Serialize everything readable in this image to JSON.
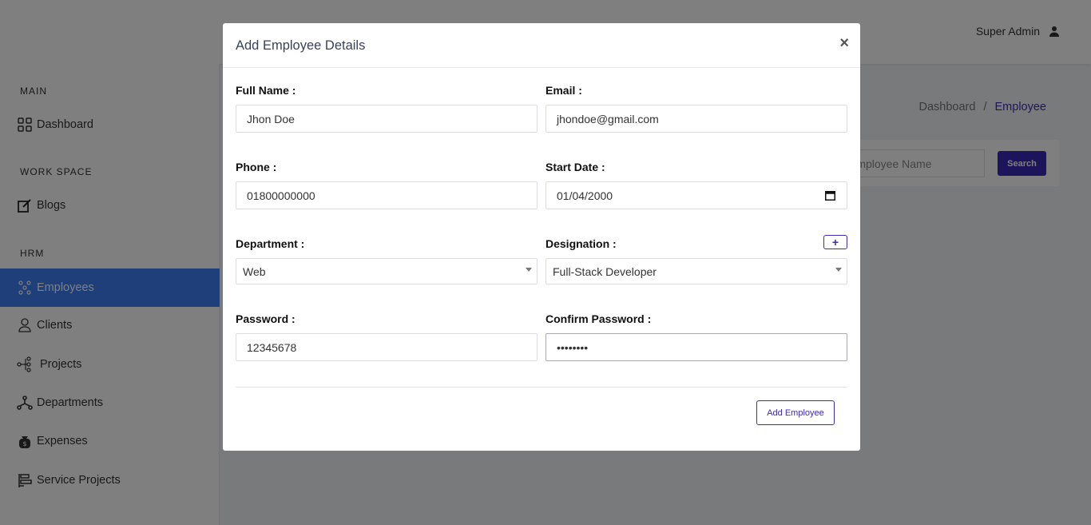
{
  "header": {
    "user_name": "Super Admin"
  },
  "sidebar": {
    "sections": [
      "MAIN",
      "WORK SPACE",
      "HRM"
    ],
    "items": [
      {
        "label": "Dashboard",
        "icon": "grid-icon"
      },
      {
        "label": "Blogs",
        "icon": "edit-icon"
      },
      {
        "label": "Employees",
        "icon": "users-icon",
        "active": true
      },
      {
        "label": "Clients",
        "icon": "user-icon"
      },
      {
        "label": "Projects",
        "icon": "nodes-icon"
      },
      {
        "label": "Departments",
        "icon": "hierarchy-icon"
      },
      {
        "label": "Expenses",
        "icon": "money-bag-icon"
      },
      {
        "label": "Service Projects",
        "icon": "tasks-icon"
      }
    ]
  },
  "page": {
    "breadcrumb": [
      "Dashboard",
      "Employee"
    ],
    "breadcrumb_sep": "/",
    "search_placeholder": "Employee Name",
    "search_label": "Search"
  },
  "modal": {
    "title": "Add Employee Details",
    "close_glyph": "×",
    "fields": {
      "full_name": {
        "label": "Full Name :",
        "value": "Jhon Doe"
      },
      "email": {
        "label": "Email :",
        "value": "jhondoe@gmail.com"
      },
      "phone": {
        "label": "Phone :",
        "value": "01800000000"
      },
      "start_date": {
        "label": "Start Date :",
        "value": "01/04/2000"
      },
      "department": {
        "label": "Department :",
        "value": "Web"
      },
      "designation": {
        "label": "Designation :",
        "value": "Full-Stack Developer"
      },
      "password": {
        "label": "Password :",
        "value": "12345678"
      },
      "confirm_password": {
        "label": "Confirm Password :",
        "value": "••••••••"
      }
    },
    "add_designation_glyph": "+",
    "submit_label": "Add Employee"
  },
  "colors": {
    "accent": "#3b2bb8",
    "active_nav": "#3d7ef4"
  }
}
